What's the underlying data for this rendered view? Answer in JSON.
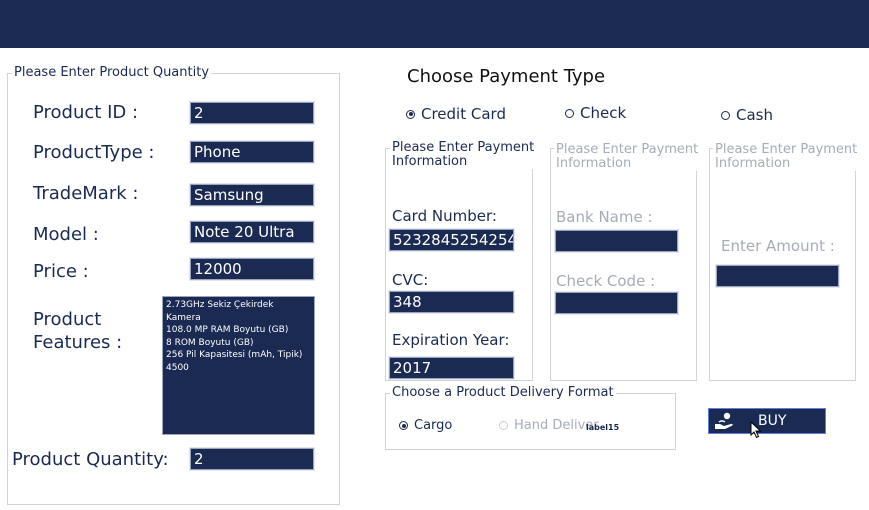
{
  "colors": {
    "navy": "#1b2a52",
    "disabled_text": "#a6acb5",
    "border": "#cfd3d8"
  },
  "quantity_group": {
    "title": "Please Enter Product Quantity"
  },
  "product": {
    "id_label": "Product ID :",
    "id_value": "2",
    "type_label": "ProductType :",
    "type_value": "Phone",
    "trademark_label": "TradeMark :",
    "trademark_value": "Samsung",
    "model_label": "Model :",
    "model_value": "Note 20 Ultra",
    "price_label": "Price :",
    "price_value": "12000",
    "features_label": "Product\nFeatures :",
    "features_value": "2.73GHz Sekiz Çekirdek\nKamera\n108.0 MP RAM Boyutu (GB)\n8 ROM Boyutu (GB)\n256 Pil Kapasitesi (mAh, Tipik)\n4500",
    "quantity_label": "Product Quantity:",
    "quantity_value": "2"
  },
  "payment": {
    "title": "Choose Payment Type",
    "options": [
      {
        "label": "Credit Card",
        "selected": true
      },
      {
        "label": "Check",
        "selected": false
      },
      {
        "label": "Cash",
        "selected": false
      }
    ],
    "group_title": "Please Enter Payment\nInformation",
    "card_number_label": "Card Number:",
    "card_number_value": "5232845254254",
    "cvc_label": "CVC:",
    "cvc_value": "348",
    "expiration_label": "Expiration Year:",
    "expiration_value": "2017",
    "bank_name_label": "Bank Name :",
    "bank_name_value": "",
    "check_code_label": "Check Code :",
    "check_code_value": "",
    "amount_label": "Enter Amount :",
    "amount_value": ""
  },
  "delivery": {
    "title": "Choose a Product Delivery Format",
    "options": [
      {
        "label": "Cargo",
        "selected": true
      },
      {
        "label": "Hand Deliver",
        "selected": false
      }
    ],
    "stray_label": "label15"
  },
  "buy_button": {
    "label": "BUY",
    "icon": "hand-money-icon"
  },
  "cursor": {
    "icon": "pointer-cursor-icon"
  }
}
